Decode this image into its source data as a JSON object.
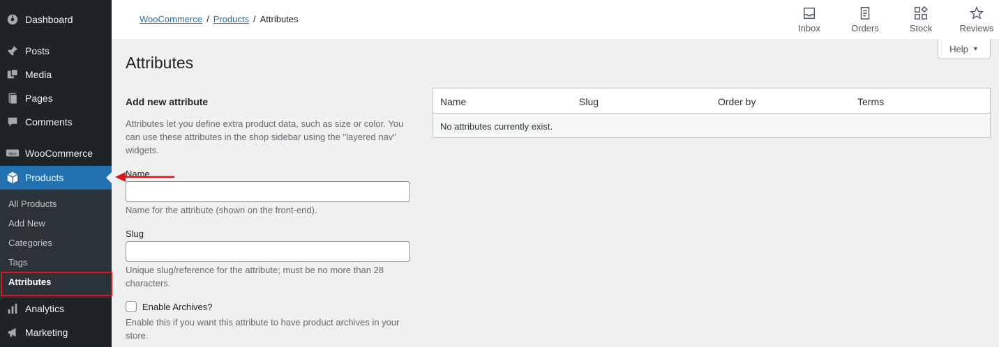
{
  "sidebar": {
    "menu": [
      {
        "label": "Dashboard",
        "icon": "dashboard-icon"
      },
      {
        "label": "Posts",
        "icon": "pin-icon"
      },
      {
        "label": "Media",
        "icon": "media-icon"
      },
      {
        "label": "Pages",
        "icon": "pages-icon"
      },
      {
        "label": "Comments",
        "icon": "comment-icon"
      },
      {
        "label": "WooCommerce",
        "icon": "woocommerce-icon"
      },
      {
        "label": "Products",
        "icon": "box-icon"
      },
      {
        "label": "Analytics",
        "icon": "bar-chart-icon"
      },
      {
        "label": "Marketing",
        "icon": "megaphone-icon"
      }
    ],
    "submenu": [
      "All Products",
      "Add New",
      "Categories",
      "Tags",
      "Attributes"
    ]
  },
  "topbar": {
    "breadcrumb": {
      "item1": "WooCommerce",
      "sep": "/",
      "item2": "Products",
      "current": "Attributes"
    },
    "actions": [
      {
        "label": "Inbox",
        "icon": "inbox-icon"
      },
      {
        "label": "Orders",
        "icon": "orders-icon"
      },
      {
        "label": "Stock",
        "icon": "stock-icon"
      },
      {
        "label": "Reviews",
        "icon": "star-icon"
      }
    ]
  },
  "page": {
    "title": "Attributes",
    "help": "Help",
    "help_arrow": "▼"
  },
  "form": {
    "title": "Add new attribute",
    "intro": "Attributes let you define extra product data, such as size or color. You can use these attributes in the shop sidebar using the \"layered nav\" widgets.",
    "name_label": "Name",
    "name_value": "",
    "name_help": "Name for the attribute (shown on the front-end).",
    "slug_label": "Slug",
    "slug_value": "",
    "slug_help": "Unique slug/reference for the attribute; must be no more than 28 characters.",
    "archives_label": "Enable Archives?",
    "archives_help": "Enable this if you want this attribute to have product archives in your store."
  },
  "table": {
    "headers": [
      "Name",
      "Slug",
      "Order by",
      "Terms"
    ],
    "empty_text": "No attributes currently exist."
  },
  "colors": {
    "sidebar_bg": "#1d2327",
    "accent": "#2271b1",
    "annotation": "#e0141e"
  }
}
